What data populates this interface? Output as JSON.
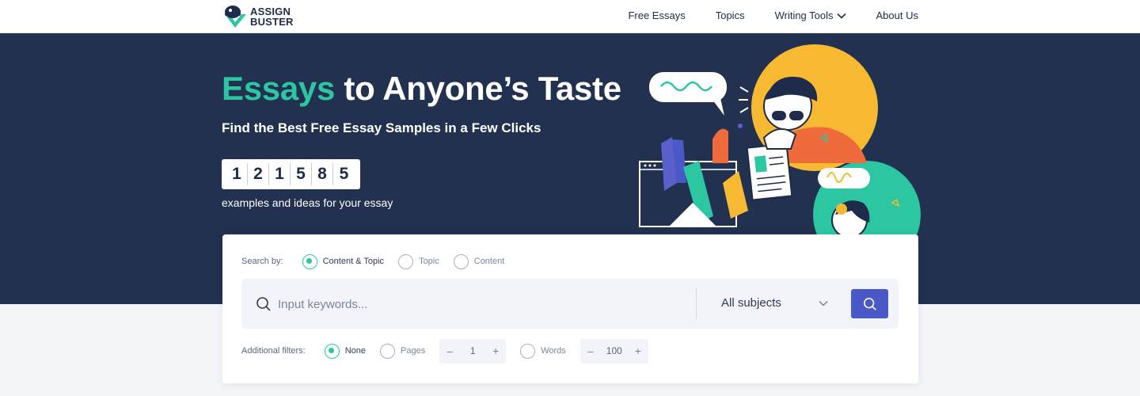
{
  "header": {
    "logo_line1": "ASSIGN",
    "logo_line2": "BUSTER",
    "nav": [
      "Free Essays",
      "Topics",
      "Writing Tools",
      "About Us"
    ]
  },
  "hero": {
    "title_accent": "Essays",
    "title_rest": " to Anyone’s Taste",
    "subtitle": "Find the Best Free Essay Samples in a Few Clicks",
    "counter_digits": [
      "1",
      "2",
      "1",
      "5",
      "8",
      "5"
    ],
    "caption": "examples and ideas for your essay"
  },
  "search": {
    "search_by_label": "Search by:",
    "search_by_options": [
      "Content & Topic",
      "Topic",
      "Content"
    ],
    "selected_search_by": "Content & Topic",
    "placeholder": "Input keywords...",
    "subjects": "All subjects",
    "filters_label": "Additional filters:",
    "filter_options": [
      "None",
      "Pages",
      "Words"
    ],
    "selected_filter": "None",
    "pages_value": "1",
    "words_value": "100",
    "minus": "–",
    "plus": "+"
  },
  "colors": {
    "accent": "#2cc6a2",
    "hero_bg": "#22314f",
    "button": "#4b58c7"
  },
  "icons": [
    "logo-icon",
    "chevron-down-icon",
    "search-icon",
    "hero-illustration"
  ]
}
